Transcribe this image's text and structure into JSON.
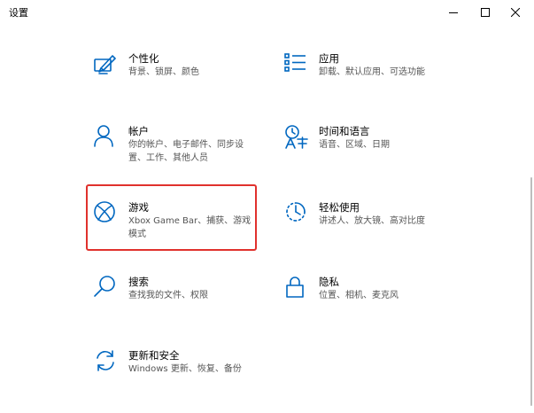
{
  "window": {
    "title": "设置",
    "controls": {
      "minimize_icon": "minimize-icon",
      "maximize_icon": "maximize-icon",
      "close_icon": "close-icon"
    }
  },
  "accent_color": "#0067c0",
  "highlight_color": "#e0312d",
  "tiles": [
    {
      "id": "personalization",
      "label": "个性化",
      "desc": "背景、锁屏、颜色",
      "icon": "personalization-icon"
    },
    {
      "id": "apps",
      "label": "应用",
      "desc": "卸载、默认应用、可选功能",
      "icon": "apps-icon"
    },
    {
      "id": "accounts",
      "label": "帐户",
      "desc": "你的帐户、电子邮件、同步设置、工作、其他人员",
      "icon": "accounts-icon"
    },
    {
      "id": "time-language",
      "label": "时间和语言",
      "desc": "语音、区域、日期",
      "icon": "time-language-icon"
    },
    {
      "id": "gaming",
      "label": "游戏",
      "desc": "Xbox Game Bar、捕获、游戏模式",
      "icon": "xbox-icon"
    },
    {
      "id": "ease-of-access",
      "label": "轻松使用",
      "desc": "讲述人、放大镜、高对比度",
      "icon": "ease-of-access-icon"
    },
    {
      "id": "search",
      "label": "搜索",
      "desc": "查找我的文件、权限",
      "icon": "search-icon"
    },
    {
      "id": "privacy",
      "label": "隐私",
      "desc": "位置、相机、麦克风",
      "icon": "lock-icon"
    },
    {
      "id": "update-security",
      "label": "更新和安全",
      "desc": "Windows 更新、恢复、备份",
      "icon": "sync-icon"
    }
  ]
}
